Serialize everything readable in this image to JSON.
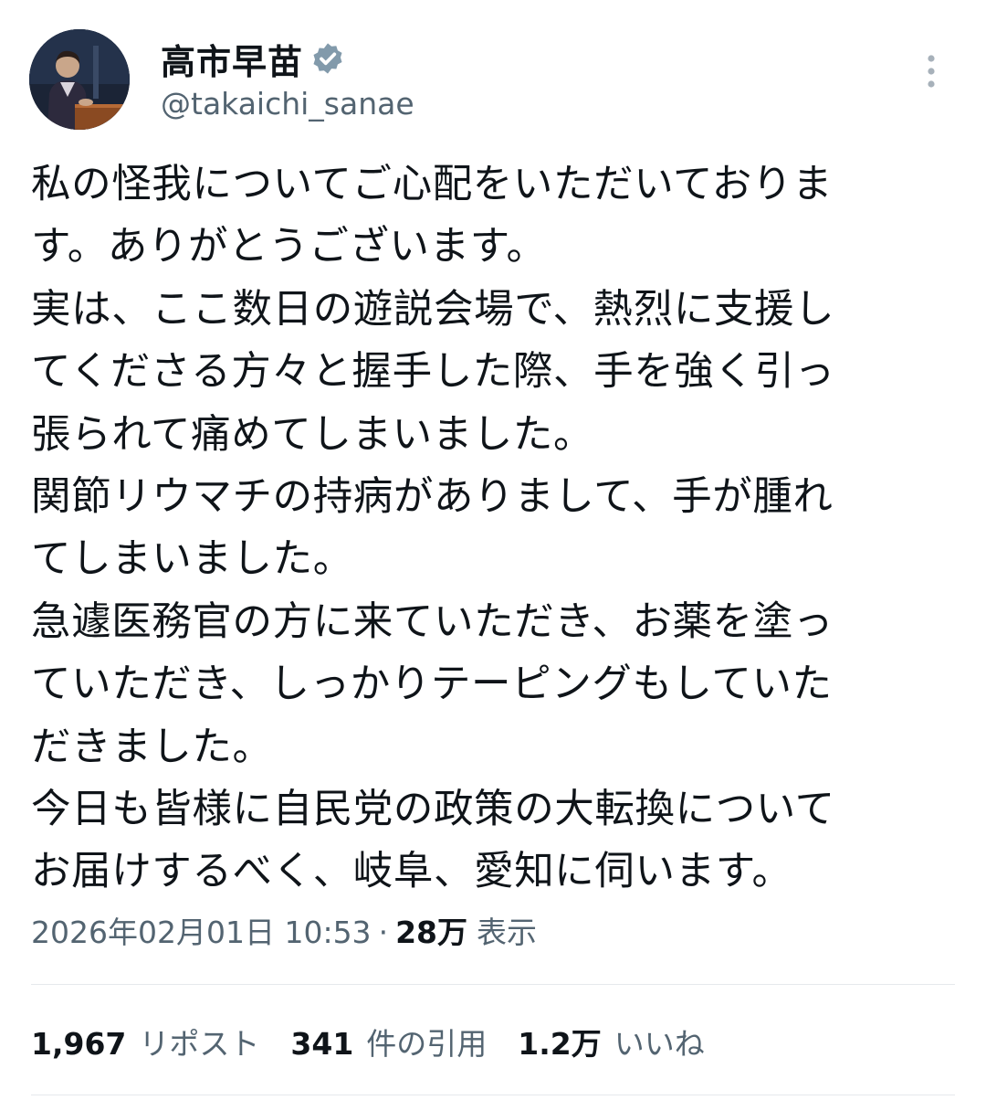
{
  "author": {
    "display_name": "高市早苗",
    "handle": "@takaichi_sanae",
    "verified_icon": "verified-badge-icon",
    "avatar_icon": "profile-photo"
  },
  "post": {
    "lines": [
      "私の怪我についてご心配をいただいておりま",
      "す。ありがとうございます。",
      "実は、ここ数日の遊説会場で、熱烈に支援し",
      "てくださる方々と握手した際、手を強く引っ",
      "張られて痛めてしまいました。",
      "関節リウマチの持病がありまして、手が腫れ",
      "てしまいました。",
      "急遽医務官の方に来ていただき、お薬を塗っ",
      "ていただき、しっかりテーピングもしていた",
      "だきました。",
      "今日も皆様に自民党の政策の大転換について",
      "お届けするべく、岐阜、愛知に伺います。"
    ]
  },
  "meta": {
    "timestamp": "2026年02月01日 10:53",
    "separator": "·",
    "views_count": "28万",
    "views_label": "表示"
  },
  "stats": {
    "reposts_count": "1,967",
    "reposts_label": "リポスト",
    "quotes_count": "341",
    "quotes_label": "件の引用",
    "likes_count": "1.2万",
    "likes_label": "いいね"
  },
  "colors": {
    "text_primary": "#0f1419",
    "text_secondary": "#536471",
    "divider": "#e6e9ec",
    "verified_badge": "#829aab"
  }
}
